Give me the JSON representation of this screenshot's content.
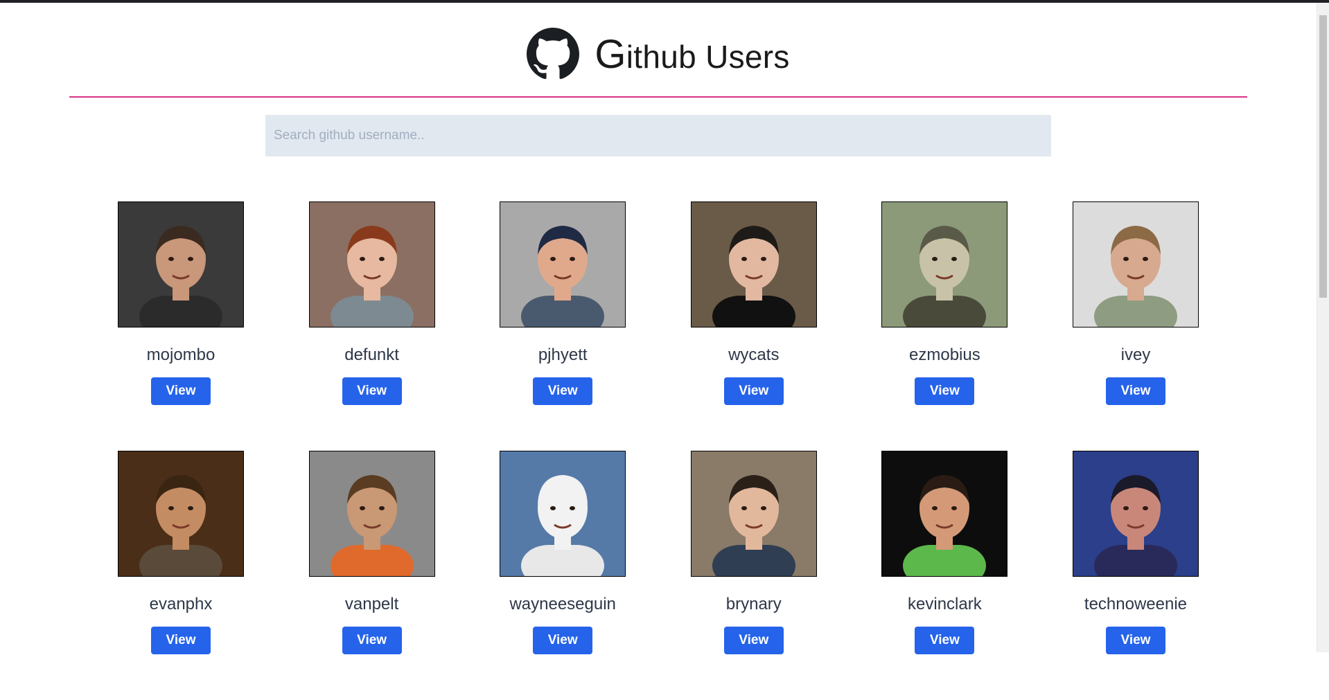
{
  "header": {
    "logo_icon": "github-octocat-icon",
    "title_first": "G",
    "title_rest": "ithub Users"
  },
  "search": {
    "placeholder": "Search github username.."
  },
  "colors": {
    "divider": "#d63384",
    "button": "#2563eb",
    "search_bg": "#e2e8f0"
  },
  "users": [
    {
      "login": "mojombo",
      "button": "View",
      "avatar_bg": "#3a3a3a",
      "skin": "#c9977a",
      "hair": "#3b2a20",
      "shirt": "#2b2b2b"
    },
    {
      "login": "defunkt",
      "button": "View",
      "avatar_bg": "#8a6f62",
      "skin": "#e6b9a0",
      "hair": "#8a3a1c",
      "shirt": "#7d8a92"
    },
    {
      "login": "pjhyett",
      "button": "View",
      "avatar_bg": "#a9a9a9",
      "skin": "#e0a98c",
      "hair": "#1f2a44",
      "shirt": "#4a5a6e"
    },
    {
      "login": "wycats",
      "button": "View",
      "avatar_bg": "#6a5a48",
      "skin": "#e2b8a0",
      "hair": "#1e1a18",
      "shirt": "#111111"
    },
    {
      "login": "ezmobius",
      "button": "View",
      "avatar_bg": "#8c9a7a",
      "skin": "#c8c3a8",
      "hair": "#5a5a48",
      "shirt": "#4a4a3a"
    },
    {
      "login": "ivey",
      "button": "View",
      "avatar_bg": "#dcdcdc",
      "skin": "#d7a98e",
      "hair": "#8b6a45",
      "shirt": "#8e9c82"
    },
    {
      "login": "evanphx",
      "button": "View",
      "avatar_bg": "#4a2e18",
      "skin": "#c48c62",
      "hair": "#3a2412",
      "shirt": "#5a4a3a"
    },
    {
      "login": "vanpelt",
      "button": "View",
      "avatar_bg": "#8a8a8a",
      "skin": "#c99874",
      "hair": "#5a3c22",
      "shirt": "#e06a2c"
    },
    {
      "login": "wayneeseguin",
      "button": "View",
      "avatar_bg": "#557aa8",
      "skin": "#f2f2f2",
      "hair": "#f2f2f2",
      "shirt": "#e8e8e8"
    },
    {
      "login": "brynary",
      "button": "View",
      "avatar_bg": "#8a7a68",
      "skin": "#e2b89c",
      "hair": "#2a2018",
      "shirt": "#2f3e52"
    },
    {
      "login": "kevinclark",
      "button": "View",
      "avatar_bg": "#0d0d0d",
      "skin": "#d49a78",
      "hair": "#2a1c14",
      "shirt": "#5cb84a"
    },
    {
      "login": "technoweenie",
      "button": "View",
      "avatar_bg": "#2b3f8a",
      "skin": "#c9877a",
      "hair": "#1a1a2a",
      "shirt": "#2a2a5a"
    }
  ]
}
